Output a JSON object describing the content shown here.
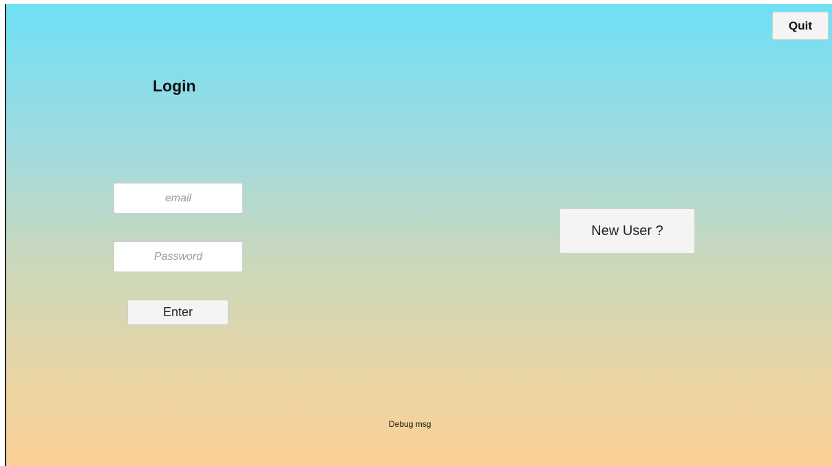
{
  "login": {
    "title": "Login",
    "email_placeholder": "email",
    "password_placeholder": "Password",
    "enter_label": "Enter"
  },
  "new_user": {
    "label": "New User ?"
  },
  "quit": {
    "label": "Quit"
  },
  "debug": {
    "message": "Debug msg"
  },
  "colors": {
    "gradient_top": "#6fe0f5",
    "gradient_bottom": "#fbd196",
    "button_bg": "#f4f4f4"
  }
}
